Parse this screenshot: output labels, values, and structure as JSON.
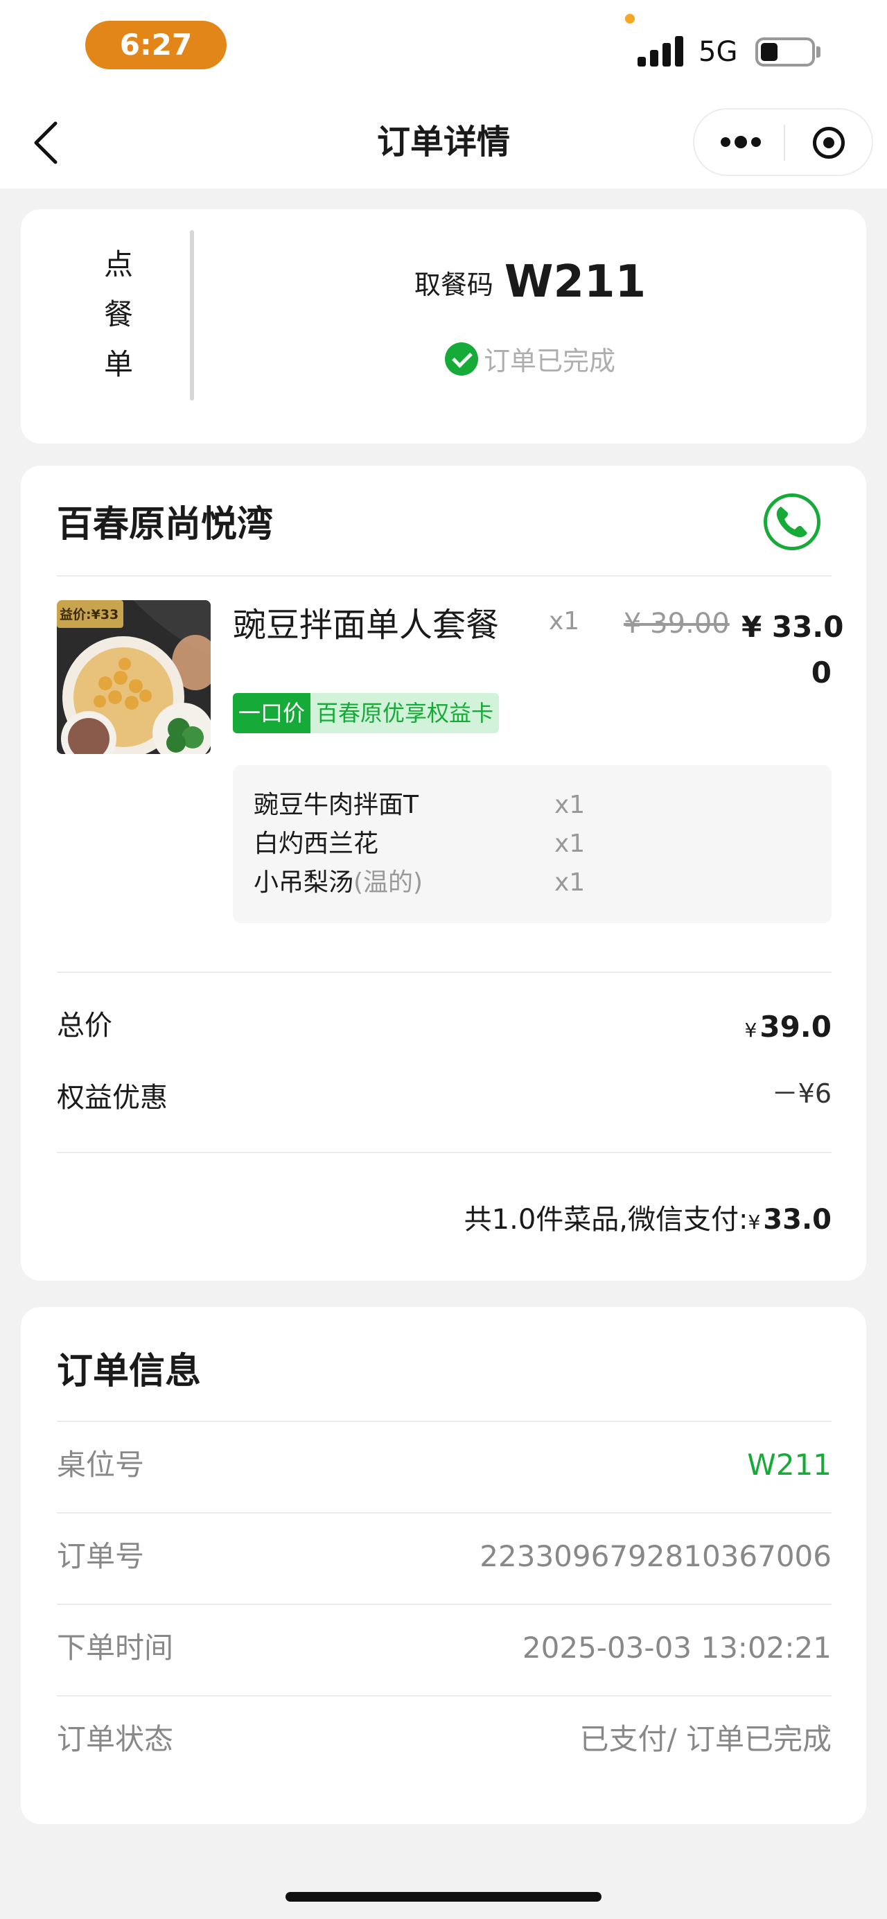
{
  "status_bar": {
    "time": "6:27",
    "network": "5G"
  },
  "nav": {
    "title": "订单详情"
  },
  "pickup": {
    "tag_chars": [
      "点",
      "餐",
      "单"
    ],
    "label": "取餐码",
    "code": "W211",
    "status": "订单已完成"
  },
  "store": {
    "name": "百春原尚悦湾",
    "item": {
      "image_badge": "益价:¥33",
      "name": "豌豆拌面单人套餐",
      "qty": "x1",
      "original_price": "¥ 39.00",
      "price_line1": "¥ 33.0",
      "price_line2": "0",
      "badge_tag": "一口价",
      "badge_text": "百春原优享权益卡",
      "sub_items": [
        {
          "name": "豌豆牛肉拌面T",
          "note": "",
          "qty": "x1"
        },
        {
          "name": "白灼西兰花",
          "note": "",
          "qty": "x1"
        },
        {
          "name": "小吊梨汤",
          "note": "(温的)",
          "qty": "x1"
        }
      ]
    },
    "summary": {
      "total_label": "总价",
      "total_currency": "¥",
      "total_value": "39.0",
      "discount_label": "权益优惠",
      "discount_value": "－¥6",
      "footer_text": "共1.0件菜品,微信支付:",
      "footer_currency": "¥",
      "footer_value": "33.0"
    }
  },
  "order_info": {
    "title": "订单信息",
    "rows": [
      {
        "label": "桌位号",
        "value": "W211"
      },
      {
        "label": "订单号",
        "value": "2233096792810367006"
      },
      {
        "label": "下单时间",
        "value": "2025-03-03 13:02:21"
      },
      {
        "label": "订单状态",
        "value": "已支付/ 订单已完成"
      }
    ]
  },
  "colors": {
    "accent_green": "#16ab39",
    "time_pill": "#e3861a",
    "background": "#f2f2f2"
  }
}
